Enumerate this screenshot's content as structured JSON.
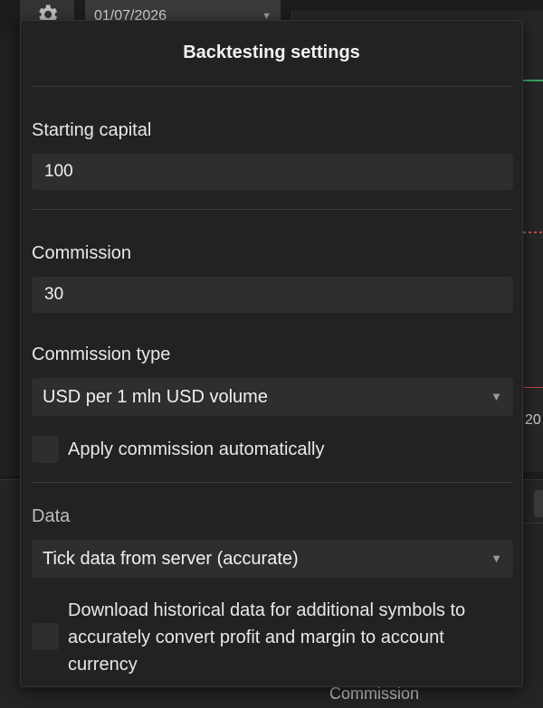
{
  "background": {
    "date_value": "01/07/2026",
    "axis_tick": "20",
    "lower_label": "Commission"
  },
  "dialog": {
    "title": "Backtesting settings",
    "starting_capital": {
      "label": "Starting capital",
      "value": "100"
    },
    "commission": {
      "label": "Commission",
      "value": "30"
    },
    "commission_type": {
      "label": "Commission type",
      "selected": "USD per 1 mln USD volume"
    },
    "apply_commission": {
      "label": "Apply commission automatically",
      "checked": false
    },
    "data": {
      "label": "Data",
      "selected": "Tick data from server (accurate)"
    },
    "download_historical": {
      "label": "Download historical data for additional symbols to accurately convert profit and margin to account currency",
      "checked": false
    }
  },
  "colors": {
    "dialog_bg": "#222222",
    "field_bg": "#2e2e2e",
    "text": "#e8e8e8"
  }
}
